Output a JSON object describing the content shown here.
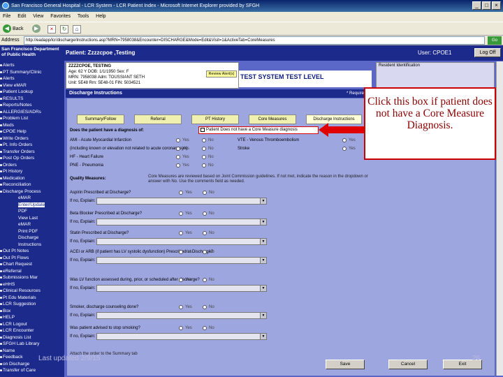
{
  "window": {
    "title": "San Francisco General Hospital - LCR System - LCR Patient Index - Microsoft Internet Explorer provided by SFGH",
    "minimize": "_",
    "maximize": "□",
    "close": "×"
  },
  "menu": [
    "File",
    "Edit",
    "View",
    "Favorites",
    "Tools",
    "Help"
  ],
  "toolbar": {
    "back": "Back"
  },
  "address": {
    "label": "Address",
    "url": "http://eadapp/lcr/discharge/Instructions.asp?MRN=7958038&Encounter=DISCHARGE&Mode=Edit&Visit=1&ActiveTab=CoreMeasures",
    "go": "Go"
  },
  "header": {
    "org": "San Francisco Department of Public Health",
    "patient": "Patient: Zzzzcpoe ,Testing",
    "user": "User: CPOE1",
    "logoff": "Log Off"
  },
  "sidebar": [
    {
      "label": "Alerts",
      "sub": false,
      "sel": false
    },
    {
      "label": "PT Summary/Clinic",
      "sub": false,
      "sel": false
    },
    {
      "label": "Alerts",
      "sub": false,
      "sel": false
    },
    {
      "label": "View eMAR",
      "sub": false,
      "sel": false
    },
    {
      "label": "Patient Lookup",
      "sub": false,
      "sel": false
    },
    {
      "label": "RESULTS",
      "sub": false,
      "sel": false
    },
    {
      "label": "Reports/Notes",
      "sub": false,
      "sel": false
    },
    {
      "label": "ALLERGIES/ADRs",
      "sub": false,
      "sel": false
    },
    {
      "label": "Problem List",
      "sub": false,
      "sel": false
    },
    {
      "label": "Meds",
      "sub": false,
      "sel": false
    },
    {
      "label": "CPOE Help",
      "sub": false,
      "sel": false
    },
    {
      "label": "Write Orders",
      "sub": false,
      "sel": false
    },
    {
      "label": "Pt. Info Orders",
      "sub": false,
      "sel": false
    },
    {
      "label": "Transfer Orders",
      "sub": false,
      "sel": false
    },
    {
      "label": "Post Op Orders",
      "sub": false,
      "sel": false
    },
    {
      "label": "Orders",
      "sub": false,
      "sel": false
    },
    {
      "label": "Pt History",
      "sub": false,
      "sel": false
    },
    {
      "label": "Medication",
      "sub": false,
      "sel": false
    },
    {
      "label": "Reconciliation",
      "sub": false,
      "sel": false
    },
    {
      "label": "Discharge Process",
      "sub": false,
      "sel": false
    },
    {
      "label": "eMAR",
      "sub": true,
      "sel": false
    },
    {
      "label": "Enter/Update",
      "sub": true,
      "sel": true
    },
    {
      "label": "PDF",
      "sub": true,
      "sel": false
    },
    {
      "label": "View Last",
      "sub": true,
      "sel": false
    },
    {
      "label": "eMAR",
      "sub": true,
      "sel": false
    },
    {
      "label": "Print PDF",
      "sub": true,
      "sel": false
    },
    {
      "label": "Discharge",
      "sub": true,
      "sel": false
    },
    {
      "label": "Instructions",
      "sub": true,
      "sel": false
    },
    {
      "label": "Out Pt Notes",
      "sub": false,
      "sel": false
    },
    {
      "label": "Out Pt Flows",
      "sub": false,
      "sel": false
    },
    {
      "label": "Chart Request",
      "sub": false,
      "sel": false
    },
    {
      "label": "eReferral",
      "sub": false,
      "sel": false
    },
    {
      "label": "Submissions Mar",
      "sub": false,
      "sel": false
    },
    {
      "label": "eHHS",
      "sub": false,
      "sel": false
    },
    {
      "label": "Clinical Resources",
      "sub": false,
      "sel": false
    },
    {
      "label": "Pt Edu Materials",
      "sub": false,
      "sel": false
    },
    {
      "label": "LCR Suggestion",
      "sub": false,
      "sel": false
    },
    {
      "label": "Box",
      "sub": false,
      "sel": false
    },
    {
      "label": "HELP",
      "sub": false,
      "sel": false
    },
    {
      "label": "LCR Logout",
      "sub": false,
      "sel": false
    },
    {
      "label": "LCR Encounter",
      "sub": false,
      "sel": false
    },
    {
      "label": "Diagnosis List",
      "sub": false,
      "sel": false
    },
    {
      "label": "SFGH Lab Library",
      "sub": false,
      "sel": false
    },
    {
      "label": "Name",
      "sub": false,
      "sel": false
    },
    {
      "label": "Feedback",
      "sub": false,
      "sel": false
    },
    {
      "label": "on Discharge",
      "sub": false,
      "sel": false
    },
    {
      "label": "Transfer of Care",
      "sub": false,
      "sel": false
    }
  ],
  "patient_info": {
    "name": "ZZZZCPOE, TESTING",
    "line1": "Age:   62 Y    DOB:    1/1/1950       Sex:  F",
    "line2": "MRN:  7958038     Adm:    TOUSSIANT SETH",
    "line3": "Unit:   5E48       Rm:   5E48-01    FIN:   5034521",
    "order_btn": "Review Alert(s)",
    "attending_label": "Resident Identification"
  },
  "test_level": "TEST SYSTEM TEST LEVEL",
  "section_title": "Discharge Instructions",
  "section_right": "* Required",
  "tabs": [
    "Summary/Follow",
    "Referral",
    "PT History",
    "Core Measures",
    "Discharge Instructions"
  ],
  "form": {
    "diag_question": "Does the patient have a diagnosis of:",
    "core_checkbox": "Patient Does not have a Core Measure diagnosis",
    "conditions": [
      {
        "label": "AMI - Acute Myocardial Infarction",
        "yes": "Yes",
        "no": "No"
      },
      {
        "label": "(including known or elevation not related to acute coronary syn)",
        "yes": "Yes",
        "no": "No"
      },
      {
        "label": "HF - Heart Failure",
        "yes": "Yes",
        "no": "No"
      },
      {
        "label": "PNE - Pneumonia",
        "yes": "Yes",
        "no": "No"
      }
    ],
    "right_conditions": [
      {
        "label": "VTE - Venous Thromboembolism",
        "yes": "Yes",
        "no": "No"
      },
      {
        "label": "Stroke",
        "yes": "Yes",
        "no": "No"
      }
    ],
    "quality_label": "Quality Measures:",
    "quality_text": "Core Measures are reviewed based on Joint Commission guidelines. If not met, indicate the reason in the dropdown or answer with No. Use the comments field as needed.",
    "questions": [
      {
        "q": "Aspirin Prescribed at Discharge?",
        "explain": "If no, Explain:",
        "yes": "Yes",
        "no": "No"
      },
      {
        "q": "Beta Blocker Prescribed at Discharge?",
        "explain": "If no, Explain:",
        "yes": "Yes",
        "no": "No"
      },
      {
        "q": "Statin Prescribed at Discharge?",
        "explain": "If no, Explain:",
        "yes": "Yes",
        "no": "No"
      },
      {
        "q": "ACEI or ARB (if patient has LV systolic dysfunction) Prescribed at Discharge?",
        "explain": "If no, Explain:",
        "yes": "Yes",
        "no": "No"
      },
      {
        "q": "Was LV function assessed during, prior, or scheduled after discharge?",
        "explain": "If no, Explain:",
        "yes": "Yes",
        "no": "No"
      },
      {
        "q": "Smoker, discharge counseling done?",
        "explain": "If no, Explain:",
        "yes": "Yes",
        "no": "No"
      },
      {
        "q": "Was patient advised to stop smoking?",
        "explain": "If no, Explain:",
        "yes": "Yes",
        "no": "No"
      }
    ],
    "bottom_note": "Attach the order to the Summary tab"
  },
  "buttons": {
    "save": "Save",
    "cancel": "Cancel",
    "exit": "Exit"
  },
  "callout": "Click this box if patient does not have a Core Measure Diagnosis.",
  "footer": {
    "date": "Last updated 2/9/15",
    "page": "26"
  },
  "colors": {
    "nav": "#1c2a8c",
    "panel": "#9ea6e0",
    "callout_border": "#c00000",
    "callout_text": "#8b0000",
    "arrow": "#e00000"
  }
}
